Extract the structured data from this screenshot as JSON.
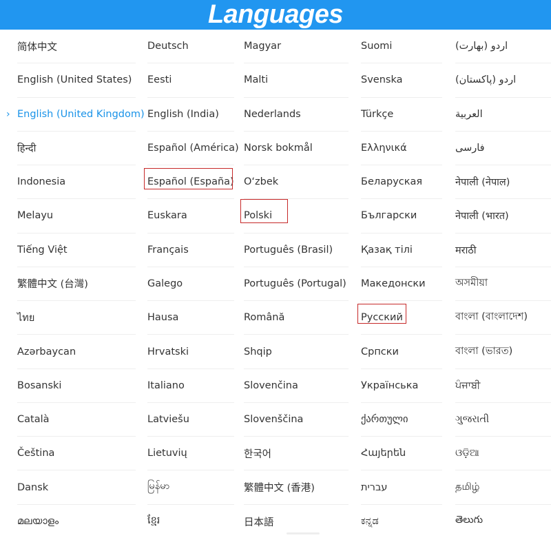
{
  "header": {
    "title": "Languages"
  },
  "colors": {
    "header_bg": "#2196f0",
    "selected_text": "#1a93e8",
    "highlight_box": "#c62828"
  },
  "selected_marker": "›",
  "columns": [
    [
      "简体中文",
      "English (United States)",
      "English (United Kingdom)",
      "हिन्दी",
      "Indonesia",
      "Melayu",
      "Tiếng Việt",
      "繁體中文 (台灣)",
      "ไทย",
      "Azərbaycan",
      "Bosanski",
      "Català",
      "Čeština",
      "Dansk",
      "മലയാളം"
    ],
    [
      "Deutsch",
      "Eesti",
      "English (India)",
      "Español (América)",
      "Español (España)",
      "Euskara",
      "Français",
      "Galego",
      "Hausa",
      "Hrvatski",
      "Italiano",
      "Latviešu",
      "Lietuvių",
      "မြန်မာ",
      "ខ្មែរ"
    ],
    [
      "Magyar",
      "Malti",
      "Nederlands",
      "Norsk bokmål",
      "O‘zbek",
      "Polski",
      "Português (Brasil)",
      "Português (Portugal)",
      "Română",
      "Shqip",
      "Slovenčina",
      "Slovenščina",
      "한국어",
      "繁體中文 (香港)",
      "日本語"
    ],
    [
      "Suomi",
      "Svenska",
      "Türkçe",
      "Ελληνικά",
      "Беларуская",
      "Български",
      "Қазақ тілі",
      "Македонски",
      "Русский",
      "Српски",
      "Українська",
      "ქართული",
      "Հայերեն",
      "עברית",
      "ಕನ್ನಡ"
    ],
    [
      "اردو (بھارت)",
      "اردو (پاکستان)",
      "العربية",
      "فارسی",
      "नेपाली (नेपाल)",
      "नेपाली (भारत)",
      "मराठी",
      "অসমীয়া",
      "বাংলা (বাংলাদেশ)",
      "বাংলা (ভারত)",
      "ਪੰਜਾਬੀ",
      "ગુજરાતી",
      "ଓଡ଼ିଆ",
      "தமிழ்",
      "తెలుగు"
    ]
  ]
}
